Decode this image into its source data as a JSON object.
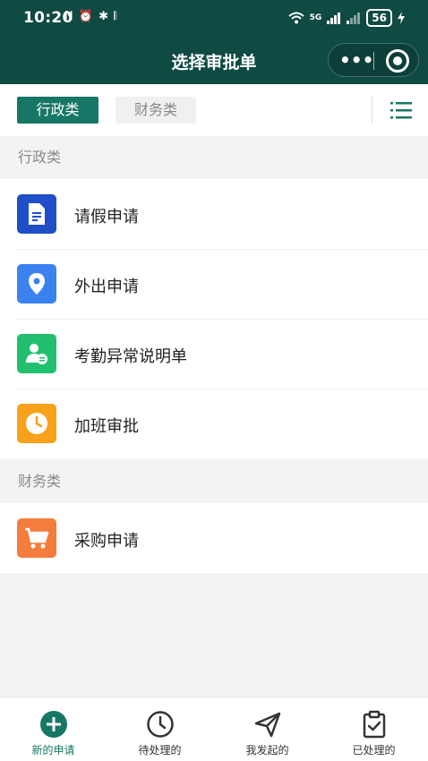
{
  "status_bar": {
    "time": "10:20",
    "left_icons": "N ⏰ ✱ 𝄃",
    "network": "5G",
    "battery": "56"
  },
  "nav": {
    "title": "选择审批单"
  },
  "tabs": [
    {
      "label": "行政类",
      "active": true
    },
    {
      "label": "财务类",
      "active": false
    }
  ],
  "sections": [
    {
      "title": "行政类",
      "items": [
        {
          "label": "请假申请",
          "icon": "document-icon",
          "color": "#1f4fc7"
        },
        {
          "label": "外出申请",
          "icon": "location-pin-icon",
          "color": "#3b82f0"
        },
        {
          "label": "考勤异常说明单",
          "icon": "user-clock-icon",
          "color": "#22c06e"
        },
        {
          "label": "加班审批",
          "icon": "clock-icon",
          "color": "#f7a21a"
        }
      ]
    },
    {
      "title": "财务类",
      "items": [
        {
          "label": "采购申请",
          "icon": "cart-icon",
          "color": "#f47c3c"
        }
      ]
    }
  ],
  "tabbar": [
    {
      "label": "新的申请",
      "icon": "add-circle-icon",
      "active": true
    },
    {
      "label": "待处理的",
      "icon": "clock-outline-icon",
      "active": false
    },
    {
      "label": "我发起的",
      "icon": "send-icon",
      "active": false
    },
    {
      "label": "已处理的",
      "icon": "clipboard-check-icon",
      "active": false
    }
  ],
  "colors": {
    "header": "#0f4a43",
    "accent": "#177766"
  }
}
